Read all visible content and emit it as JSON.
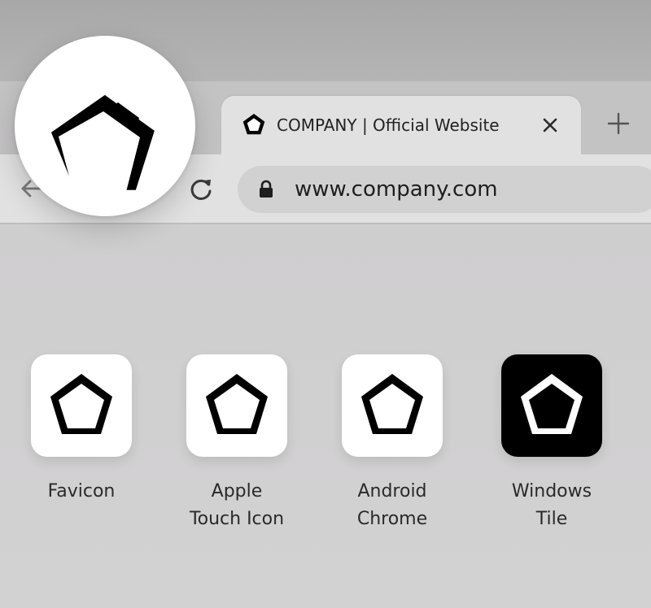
{
  "browser": {
    "tab": {
      "title": "COMPANY | Official Website",
      "favicon_icon": "pentagon-logo-icon",
      "close_icon": "close-icon"
    },
    "new_tab_icon": "plus-icon",
    "toolbar": {
      "back_icon": "back-arrow-icon",
      "reload_icon": "reload-icon"
    },
    "address_bar": {
      "lock_icon": "lock-icon",
      "url": "www.company.com"
    }
  },
  "magnified_favicon": {
    "icon": "pentagon-logo-icon"
  },
  "icon_variants": [
    {
      "label_lines": [
        "Favicon"
      ],
      "icon": "pentagon-logo-icon",
      "style": "light"
    },
    {
      "label_lines": [
        "Apple",
        "Touch Icon"
      ],
      "icon": "pentagon-logo-icon",
      "style": "light"
    },
    {
      "label_lines": [
        "Android",
        "Chrome"
      ],
      "icon": "pentagon-logo-icon",
      "style": "light"
    },
    {
      "label_lines": [
        "Windows",
        "Tile"
      ],
      "icon": "pentagon-logo-icon",
      "style": "dark"
    }
  ],
  "colors": {
    "logo_dark": "#000000",
    "logo_light": "#ffffff",
    "tab_active": "#e2e1e2",
    "address_bar": "#d2d1d2"
  }
}
